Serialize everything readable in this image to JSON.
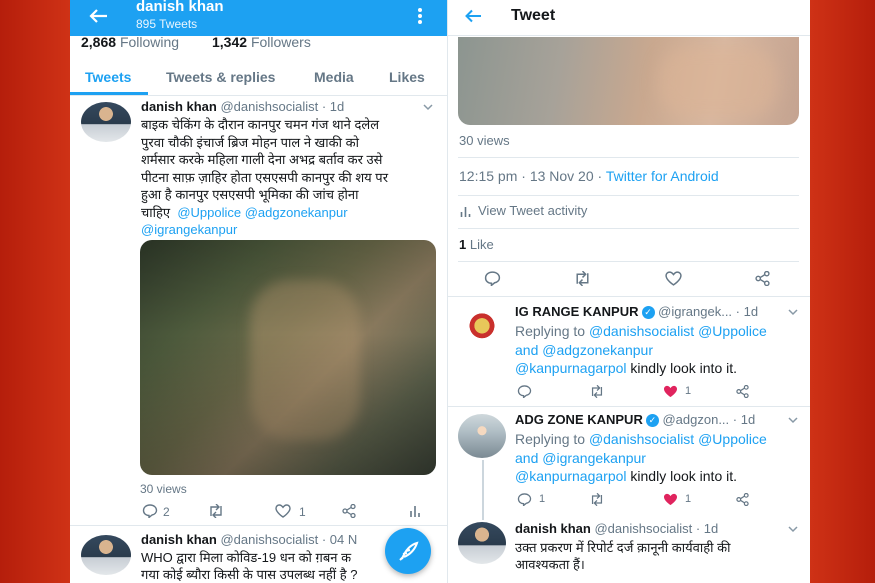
{
  "left": {
    "header": {
      "name": "danish khan",
      "tweets_count": "895 Tweets"
    },
    "stats": {
      "following_count": "2,868",
      "following_label": "Following",
      "followers_count": "1,342",
      "followers_label": "Followers"
    },
    "tabs": [
      "Tweets",
      "Tweets & replies",
      "Media",
      "Likes"
    ],
    "tweet1": {
      "name": "danish khan",
      "handle": "@danishsocialist",
      "time": "· 1d",
      "text_lines": [
        "बाइक चेकिंग के दौरान कानपुर चमन गंज थाने दलेल",
        "पुरवा चौकी इंचार्ज ब्रिज मोहन पाल ने खाकी को",
        "शर्मसार करके महिला गाली देना अभद्र बर्ताव कर उसे",
        "पीटना साफ़ ज़ाहिर होता एसएसपी कानपुर की शय पर",
        "हुआ है कानपुर एसएसपी भूमिका की जांच होना"
      ],
      "text_tail": "चाहिए",
      "mentions1": "@Uppolice @adgzonekanpur",
      "mentions2": "@igrangekanpur",
      "views": "30 views",
      "replies": "2",
      "likes": "1"
    },
    "tweet2": {
      "name": "danish khan",
      "handle": "@danishsocialist",
      "time": "· 04 N",
      "line1": "WHO द्वारा मिला कोविड-19 धन को ग़बन क",
      "line2": "गया कोई ब्यौरा किसी के पास उपलब्ध नहीं है ?"
    }
  },
  "right": {
    "header": {
      "title": "Tweet"
    },
    "views": "30 views",
    "timestamp": "12:15 pm · 13 Nov 20 · ",
    "client": "Twitter for Android",
    "activity": "View Tweet activity",
    "likes_count": "1",
    "likes_label": "Like",
    "reply1": {
      "name": "IG RANGE KANPUR",
      "handle": "@igrangek...",
      "time": "· 1d",
      "replying_label": "Replying to ",
      "replying_line1": "@danishsocialist @Uppolice",
      "replying_and": "and ",
      "replying_line2": "@adgzonekanpur",
      "mention": "@kanpurnagarpol",
      "text": " kindly look into it.",
      "likes": "1"
    },
    "reply2": {
      "name": "ADG ZONE KANPUR",
      "handle": "@adgzon...",
      "time": "· 1d",
      "replying_label": "Replying to ",
      "replying_line1": "@danishsocialist @Uppolice",
      "replying_and": "and ",
      "replying_line2": "@igrangekanpur",
      "mention": "@kanpurnagarpol",
      "text": "  kindly look into it.",
      "replies": "1",
      "likes": "1"
    },
    "reply3": {
      "name": "danish khan",
      "handle": "@danishsocialist",
      "time": "· 1d",
      "line1": "उक्त प्रकरण में रिपोर्ट दर्ज क़ानूनी कार्यवाही की",
      "line2": "आवश्यकता हैं।"
    }
  },
  "colors": {
    "accent": "#1da1f2",
    "like_red": "#e0245e",
    "background": "#c2260f"
  }
}
